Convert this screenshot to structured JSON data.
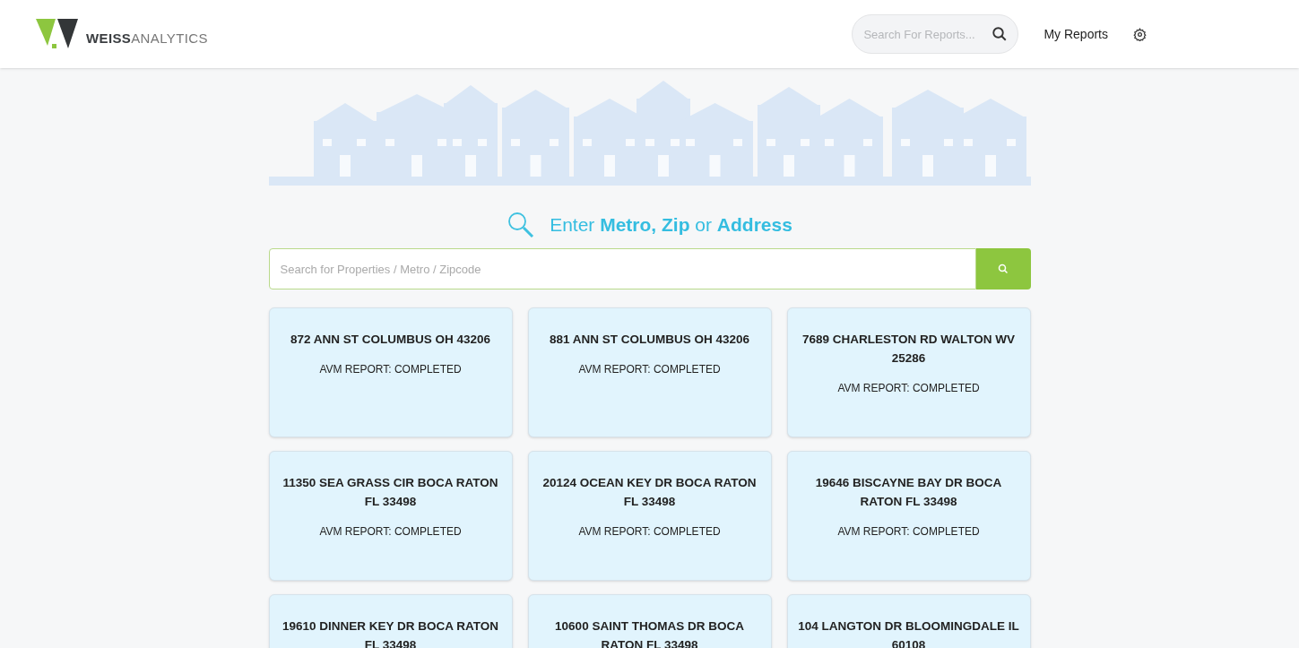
{
  "header": {
    "logo": {
      "bold": "WEISS",
      "light": "ANALYTICS"
    },
    "search": {
      "placeholder": "Search For Reports..."
    },
    "nav_link": "My Reports"
  },
  "hero": {
    "prompt": "Enter **Metro, Zip** or **Address**",
    "search": {
      "placeholder": "Search for Properties / Metro / Zipcode"
    }
  },
  "reports": [
    {
      "address": "872 ANN ST COLUMBUS OH 43206",
      "status": "AVM REPORT: COMPLETED"
    },
    {
      "address": "881 ANN ST COLUMBUS OH 43206",
      "status": "AVM REPORT: COMPLETED"
    },
    {
      "address": "7689 CHARLESTON RD WALTON WV 25286",
      "status": "AVM REPORT: COMPLETED"
    },
    {
      "address": "11350 SEA GRASS CIR BOCA RATON FL 33498",
      "status": "AVM REPORT: COMPLETED"
    },
    {
      "address": "20124 OCEAN KEY DR BOCA RATON FL 33498",
      "status": "AVM REPORT: COMPLETED"
    },
    {
      "address": "19646 BISCAYNE BAY DR BOCA RATON FL 33498",
      "status": "AVM REPORT: COMPLETED"
    },
    {
      "address": "19610 DINNER KEY DR BOCA RATON FL 33498"
    },
    {
      "address": "10600 SAINT THOMAS DR BOCA RATON FL 33498"
    },
    {
      "address": "104 LANGTON DR BLOOMINGDALE IL 60108"
    }
  ]
}
